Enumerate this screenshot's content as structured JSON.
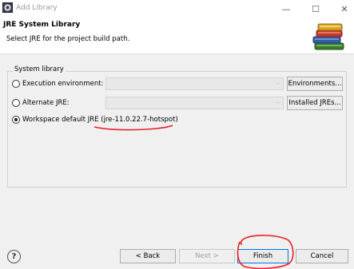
{
  "window": {
    "title": "Add Library",
    "minimize": "—",
    "maximize": "☐",
    "close": "✕"
  },
  "header": {
    "title": "JRE System Library",
    "description": "Select JRE for the project build path.",
    "icon": "books-icon"
  },
  "group": {
    "label": "System library",
    "options": [
      {
        "label": "Execution environment:",
        "selected": false,
        "button": "Environments..."
      },
      {
        "label": "Alternate JRE:",
        "selected": false,
        "button": "Installed JREs..."
      },
      {
        "label": "Workspace default JRE (jre-11.0.22.7-hotspot)",
        "selected": true
      }
    ]
  },
  "footer": {
    "help": "?",
    "back": "< Back",
    "next": "Next >",
    "finish": "Finish",
    "cancel": "Cancel"
  },
  "colors": {
    "annotation": "#e8202a",
    "focus": "#0078d7"
  }
}
